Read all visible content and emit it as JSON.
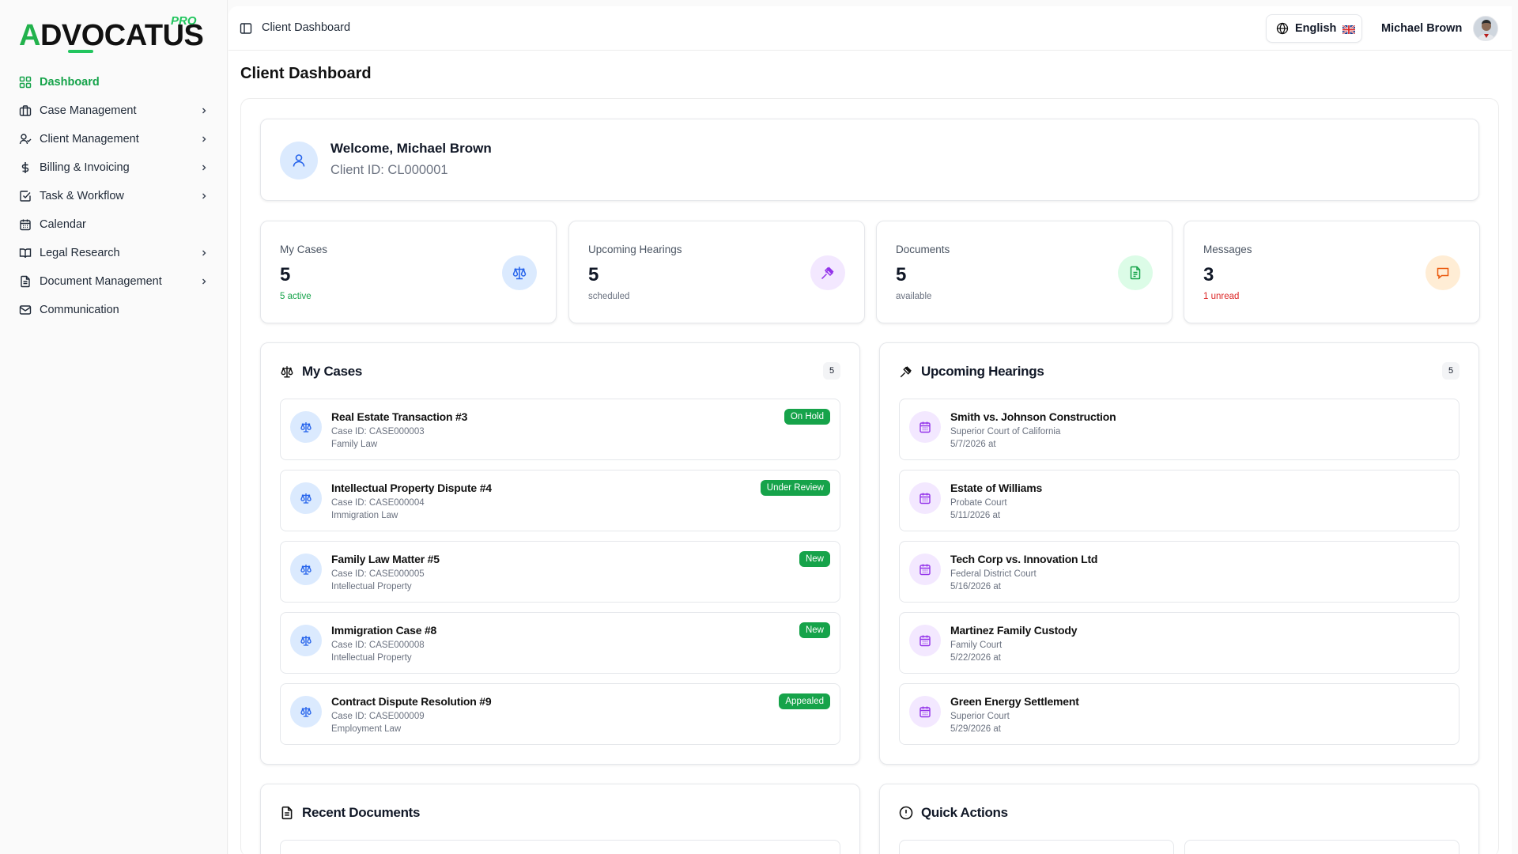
{
  "brand": {
    "name": "ADVOCATUS",
    "tier": "PRO"
  },
  "sidebar": {
    "items": [
      {
        "label": "Dashboard",
        "icon": "dashboard-icon",
        "active": true,
        "expandable": false
      },
      {
        "label": "Case Management",
        "icon": "briefcase-icon",
        "expandable": true
      },
      {
        "label": "Client Management",
        "icon": "users-icon",
        "expandable": true
      },
      {
        "label": "Billing & Invoicing",
        "icon": "dollar-icon",
        "expandable": true
      },
      {
        "label": "Task & Workflow",
        "icon": "checkbox-icon",
        "expandable": true
      },
      {
        "label": "Calendar",
        "icon": "calendar-icon",
        "expandable": false
      },
      {
        "label": "Legal Research",
        "icon": "book-icon",
        "expandable": true
      },
      {
        "label": "Document Management",
        "icon": "document-icon",
        "expandable": true
      },
      {
        "label": "Communication",
        "icon": "mail-icon",
        "expandable": false
      }
    ]
  },
  "header": {
    "breadcrumb": "Client Dashboard",
    "language": "English",
    "user_name": "Michael Brown"
  },
  "page": {
    "title": "Client Dashboard"
  },
  "welcome": {
    "title": "Welcome, Michael Brown",
    "client_id": "Client ID: CL000001"
  },
  "stats": [
    {
      "label": "My Cases",
      "value": "5",
      "sub": "5 active",
      "icon": "scale-icon",
      "color": "#2563eb",
      "bg": "#dbeafe"
    },
    {
      "label": "Upcoming Hearings",
      "value": "5",
      "sub": "scheduled",
      "icon": "gavel-icon",
      "color": "#9333ea",
      "bg": "#f3e8ff"
    },
    {
      "label": "Documents",
      "value": "5",
      "sub": "available",
      "icon": "file-icon",
      "color": "#16a34a",
      "bg": "#dcfce7"
    },
    {
      "label": "Messages",
      "value": "3",
      "sub": "1 unread",
      "icon": "message-icon",
      "color": "#ea580c",
      "bg": "#ffedd5"
    }
  ],
  "cases": {
    "title": "My Cases",
    "count": "5",
    "items": [
      {
        "title": "Real Estate Transaction #3",
        "case_id": "Case ID: CASE000003",
        "type": "Family Law",
        "status": "On Hold"
      },
      {
        "title": "Intellectual Property Dispute #4",
        "case_id": "Case ID: CASE000004",
        "type": "Immigration Law",
        "status": "Under Review"
      },
      {
        "title": "Family Law Matter #5",
        "case_id": "Case ID: CASE000005",
        "type": "Intellectual Property",
        "status": "New"
      },
      {
        "title": "Immigration Case #8",
        "case_id": "Case ID: CASE000008",
        "type": "Intellectual Property",
        "status": "New"
      },
      {
        "title": "Contract Dispute Resolution #9",
        "case_id": "Case ID: CASE000009",
        "type": "Employment Law",
        "status": "Appealed"
      }
    ]
  },
  "hearings": {
    "title": "Upcoming Hearings",
    "count": "5",
    "items": [
      {
        "title": "Smith vs. Johnson Construction",
        "court": "Superior Court of California",
        "date": "5/7/2026 at"
      },
      {
        "title": "Estate of Williams",
        "court": "Probate Court",
        "date": "5/11/2026 at"
      },
      {
        "title": "Tech Corp vs. Innovation Ltd",
        "court": "Federal District Court",
        "date": "5/16/2026 at"
      },
      {
        "title": "Martinez Family Custody",
        "court": "Family Court",
        "date": "5/22/2026 at"
      },
      {
        "title": "Green Energy Settlement",
        "court": "Superior Court",
        "date": "5/29/2026 at"
      }
    ]
  },
  "documents": {
    "title": "Recent Documents"
  },
  "quick_actions": {
    "title": "Quick Actions"
  },
  "colors": {
    "accent": "#16a34a",
    "badge": "#16a34a",
    "case_icon_bg": "#dbeafe",
    "hearing_icon_bg": "#f3e8ff"
  }
}
